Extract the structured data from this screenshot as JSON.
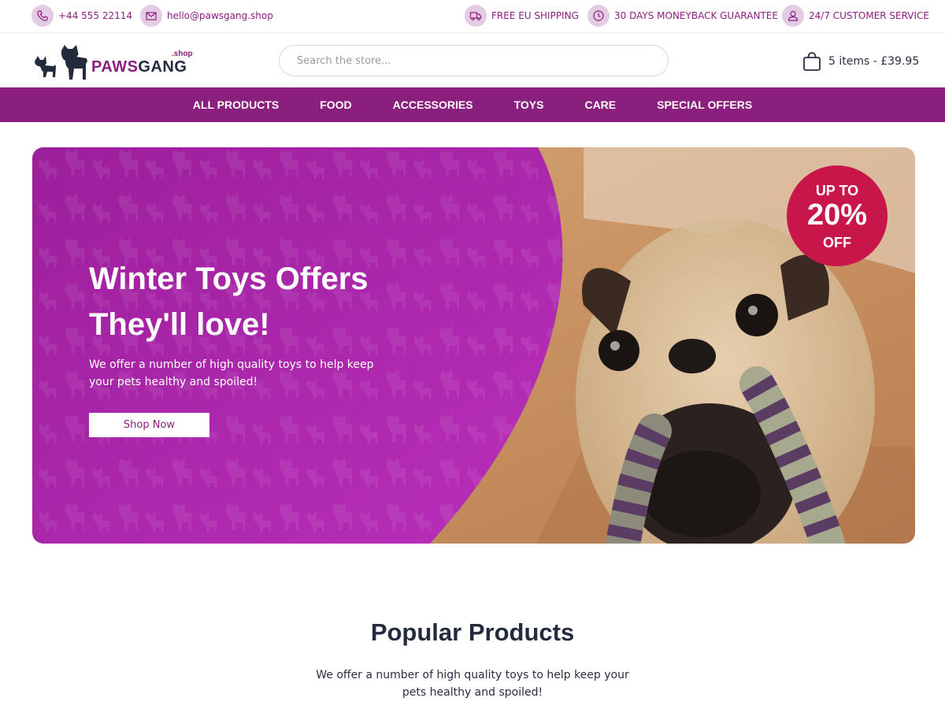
{
  "topbar": {
    "phone": "+44 555 22114",
    "email": "hello@pawsgang.shop",
    "shipping": "FREE EU SHIPPING",
    "guarantee": "30 DAYS MONEYBACK GUARANTEE",
    "service": "24/7 CUSTOMER SERVICE"
  },
  "logo": {
    "brand_first": "PAWS",
    "brand_second": "GANG",
    "tld": ".shop"
  },
  "search": {
    "placeholder": "Search the store..."
  },
  "cart": {
    "summary": "5 items - £39.95"
  },
  "nav": {
    "items": [
      {
        "label": "ALL PRODUCTS"
      },
      {
        "label": "FOOD"
      },
      {
        "label": "ACCESSORIES"
      },
      {
        "label": "TOYS"
      },
      {
        "label": "CARE"
      },
      {
        "label": "SPECIAL OFFERS"
      }
    ]
  },
  "hero": {
    "title_line1": "Winter Toys Offers",
    "title_line2": "They'll love!",
    "text": "We offer a number of high quality toys to help keep your pets healthy and spoiled!",
    "button": "Shop Now",
    "badge": {
      "top": "UP TO",
      "value": "20%",
      "bottom": "OFF"
    }
  },
  "popular": {
    "title": "Popular Products",
    "text": "We offer a number of high quality toys to help keep your pets healthy and spoiled!"
  },
  "colors": {
    "brand_purple": "#8a1f7e",
    "hero_purple": "#a925a8",
    "badge_red": "#c8154a",
    "icon_bg": "#e4cbe4",
    "dark_text": "#242b3d"
  }
}
